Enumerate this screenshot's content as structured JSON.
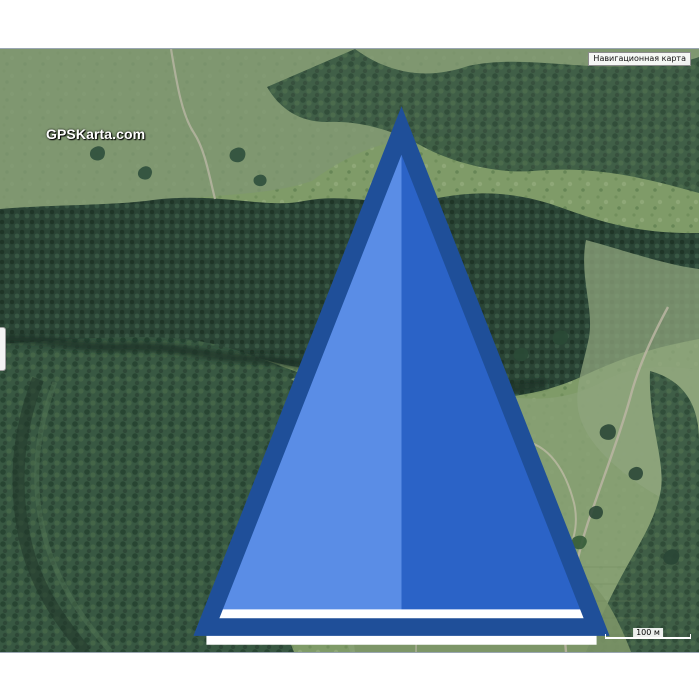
{
  "map": {
    "map_type_label": "Навигационная карта",
    "logo_text": "GPSKarta.com",
    "scale_label": "100 м"
  },
  "colors": {
    "forest_dark": "#2d4a36",
    "forest_mid": "#41603f",
    "field_green": "#708f5c",
    "field_light": "#8ca879",
    "clearing_bright": "#68a04d",
    "track": "#b8b4a0",
    "logo_blue": "#2b63c7"
  },
  "icons": {
    "logo_mark": "triangle-marker-icon",
    "left_control": "panel-handle-icon"
  }
}
